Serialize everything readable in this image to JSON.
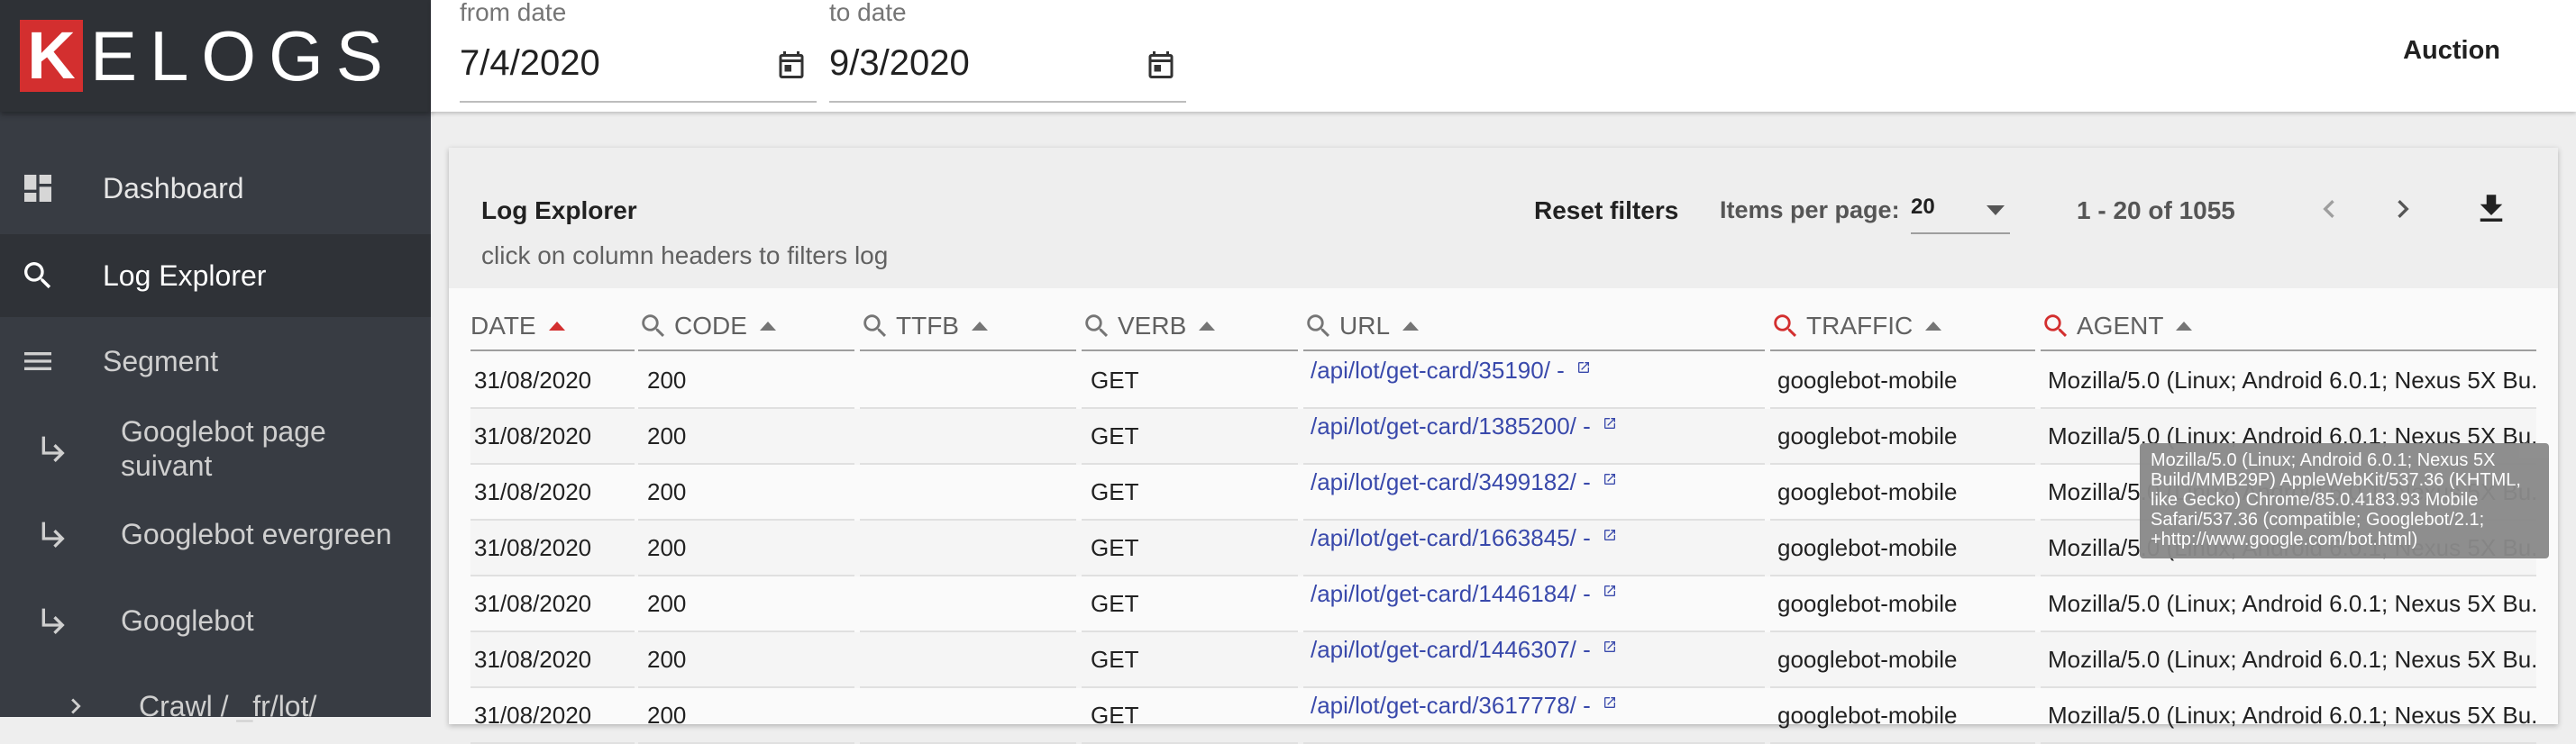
{
  "app": {
    "logo_initial": "K",
    "logo_rest": "ELOGS"
  },
  "sidebar": {
    "items": [
      {
        "label": "Dashboard",
        "icon": "dashboard-icon"
      },
      {
        "label": "Log Explorer",
        "icon": "search-icon",
        "active": true
      },
      {
        "label": "Segment",
        "icon": "menu-icon"
      },
      {
        "label": "Googlebot page suivant",
        "icon": "subdirectory-arrow-icon"
      },
      {
        "label": "Googlebot evergreen",
        "icon": "subdirectory-arrow-icon"
      },
      {
        "label": "Googlebot",
        "icon": "subdirectory-arrow-icon"
      },
      {
        "label": "Crawl / _fr/lot/",
        "icon": "chevron-right-icon"
      }
    ]
  },
  "header": {
    "from_label": "from date",
    "from_value": "7/4/2020",
    "to_label": "to date",
    "to_value": "9/3/2020",
    "auction_label": "Auction"
  },
  "explorer": {
    "title": "Log Explorer",
    "subtitle": "click on column headers to filters log",
    "reset_label": "Reset filters",
    "items_per_page_label": "Items per page:",
    "items_per_page_value": "20",
    "range_label": "1 - 20 of 1055"
  },
  "table": {
    "columns": [
      {
        "label": "DATE",
        "filter": false,
        "sort": "asc-active"
      },
      {
        "label": "CODE",
        "filter": true,
        "filter_color": "grey"
      },
      {
        "label": "TTFB",
        "filter": true,
        "filter_color": "grey"
      },
      {
        "label": "VERB",
        "filter": true,
        "filter_color": "grey"
      },
      {
        "label": "URL",
        "filter": true,
        "filter_color": "grey"
      },
      {
        "label": "TRAFFIC",
        "filter": true,
        "filter_color": "red"
      },
      {
        "label": "AGENT",
        "filter": true,
        "filter_color": "red"
      }
    ],
    "rows": [
      {
        "date": "31/08/2020",
        "code": "200",
        "ttfb": "",
        "verb": "GET",
        "url": "/api/lot/get-card/35190/ - ",
        "traffic": "googlebot-mobile",
        "agent": "Mozilla/5.0 (Linux; Android 6.0.1; Nexus 5X Bu..."
      },
      {
        "date": "31/08/2020",
        "code": "200",
        "ttfb": "",
        "verb": "GET",
        "url": "/api/lot/get-card/1385200/ - ",
        "traffic": "googlebot-mobile",
        "agent": "Mozilla/5.0 (Linux; Android 6.0.1; Nexus 5X Bu..."
      },
      {
        "date": "31/08/2020",
        "code": "200",
        "ttfb": "",
        "verb": "GET",
        "url": "/api/lot/get-card/3499182/ - ",
        "traffic": "googlebot-mobile",
        "agent": "Mozilla/5.0 (Linux; Android 6.0.1; Nexus 5X Bu..."
      },
      {
        "date": "31/08/2020",
        "code": "200",
        "ttfb": "",
        "verb": "GET",
        "url": "/api/lot/get-card/1663845/ - ",
        "traffic": "googlebot-mobile",
        "agent": "Mozilla/5.0 (Linux; Android 6.0.1; Nexus 5X Bu..."
      },
      {
        "date": "31/08/2020",
        "code": "200",
        "ttfb": "",
        "verb": "GET",
        "url": "/api/lot/get-card/1446184/ - ",
        "traffic": "googlebot-mobile",
        "agent": "Mozilla/5.0 (Linux; Android 6.0.1; Nexus 5X Bu..."
      },
      {
        "date": "31/08/2020",
        "code": "200",
        "ttfb": "",
        "verb": "GET",
        "url": "/api/lot/get-card/1446307/ - ",
        "traffic": "googlebot-mobile",
        "agent": "Mozilla/5.0 (Linux; Android 6.0.1; Nexus 5X Bu..."
      },
      {
        "date": "31/08/2020",
        "code": "200",
        "ttfb": "",
        "verb": "GET",
        "url": "/api/lot/get-card/3617778/ - ",
        "traffic": "googlebot-mobile",
        "agent": "Mozilla/5.0 (Linux; Android 6.0.1; Nexus 5X Bu..."
      }
    ]
  },
  "tooltip": {
    "text": "Mozilla/5.0 (Linux; Android 6.0.1; Nexus 5X Build/MMB29P) AppleWebKit/537.36 (KHTML, like Gecko) Chrome/85.0.4183.93 Mobile Safari/537.36 (compatible; Googlebot/2.1; +http://www.google.com/bot.html)"
  },
  "colors": {
    "sidebar_bg": "#383c43",
    "logo_accent": "#d32f2f",
    "link": "#3949ab",
    "filter_active": "#d32f2f"
  }
}
